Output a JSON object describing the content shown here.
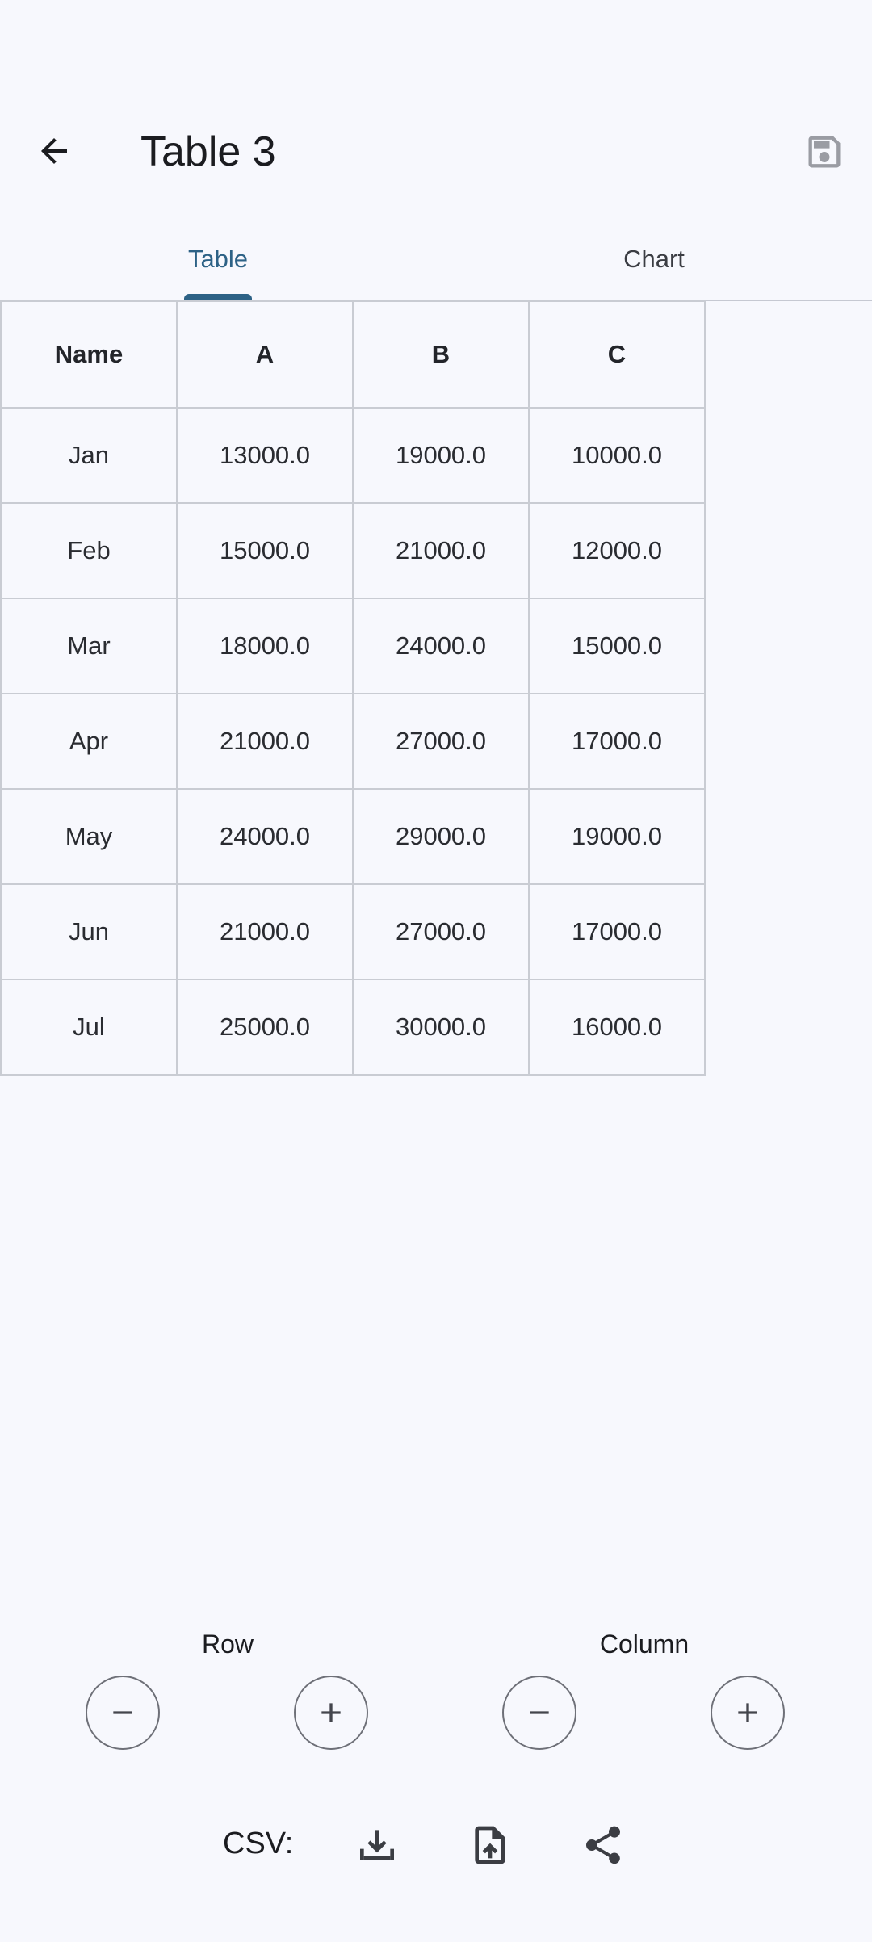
{
  "appbar": {
    "title": "Table 3",
    "back_icon": "arrow-back-icon",
    "save_icon": "save-icon"
  },
  "tabs": [
    {
      "label": "Table",
      "selected": true
    },
    {
      "label": "Chart",
      "selected": false
    }
  ],
  "table": {
    "headers": [
      "Name",
      "A",
      "B",
      "C"
    ],
    "rows": [
      [
        "Jan",
        "13000.0",
        "19000.0",
        "10000.0"
      ],
      [
        "Feb",
        "15000.0",
        "21000.0",
        "12000.0"
      ],
      [
        "Mar",
        "18000.0",
        "24000.0",
        "15000.0"
      ],
      [
        "Apr",
        "21000.0",
        "27000.0",
        "17000.0"
      ],
      [
        "May",
        "24000.0",
        "29000.0",
        "19000.0"
      ],
      [
        "Jun",
        "21000.0",
        "27000.0",
        "17000.0"
      ],
      [
        "Jul",
        "25000.0",
        "30000.0",
        "16000.0"
      ]
    ]
  },
  "controls": {
    "row_label": "Row",
    "column_label": "Column",
    "csv_label": "CSV:"
  },
  "colors": {
    "accent": "#2d6286",
    "background": "#f7f8fd",
    "grid_line": "#c9ccd3"
  }
}
